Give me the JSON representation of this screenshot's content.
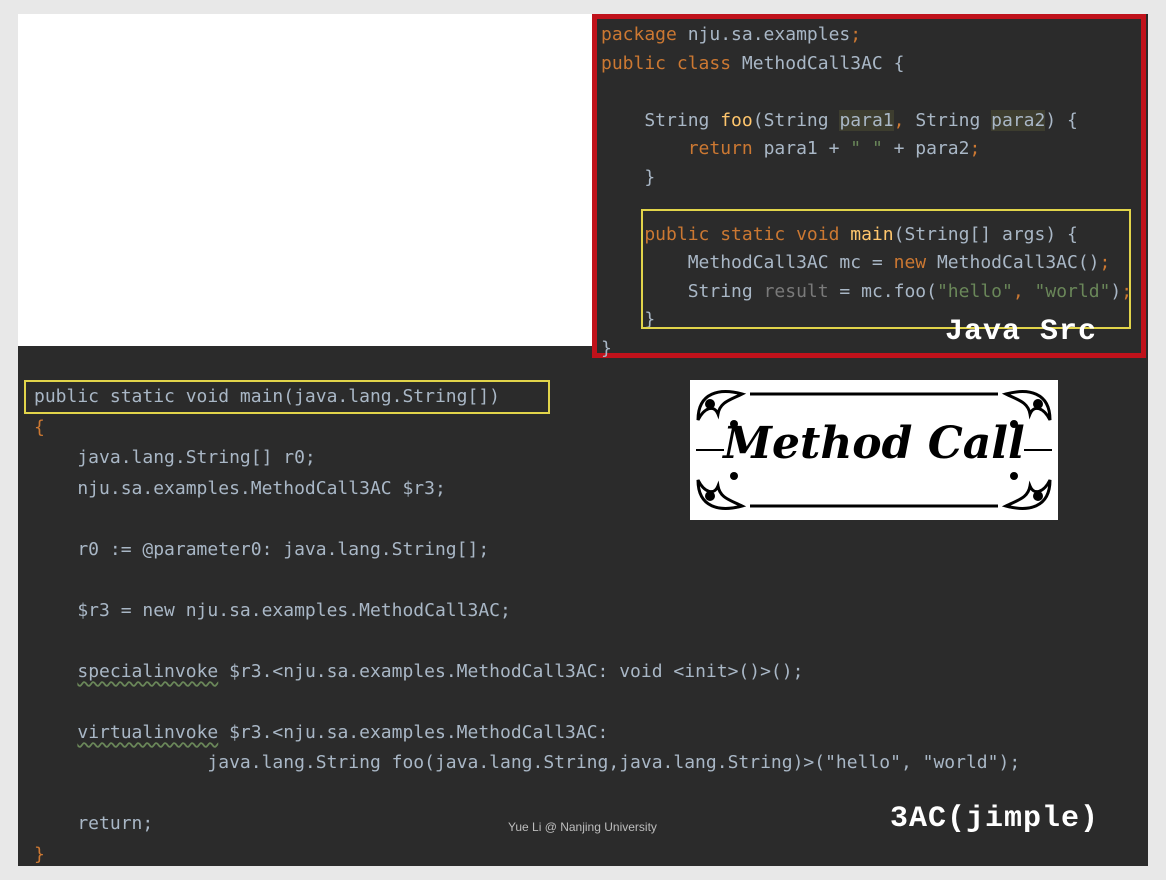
{
  "java_src": {
    "label": "Java Src",
    "lines": [
      [
        [
          "kw",
          "package "
        ],
        [
          "",
          "nju.sa.examples"
        ],
        [
          "kw",
          ";"
        ]
      ],
      [
        [
          "kw",
          "public class "
        ],
        [
          "",
          "MethodCall3AC {"
        ]
      ],
      [],
      [
        [
          "",
          "    String "
        ],
        [
          "fn",
          "foo"
        ],
        [
          "",
          "(String "
        ],
        [
          "param",
          "para1"
        ],
        [
          "kw",
          ", "
        ],
        [
          "",
          "String "
        ],
        [
          "param",
          "para2"
        ],
        [
          "",
          ") {"
        ]
      ],
      [
        [
          "kw",
          "        return "
        ],
        [
          "",
          "para1 + "
        ],
        [
          "str",
          "\" \""
        ],
        [
          "",
          " + para2"
        ],
        [
          "kw",
          ";"
        ]
      ],
      [
        [
          "",
          "    }"
        ]
      ],
      [],
      [
        [
          "kw",
          "    public static void "
        ],
        [
          "fn",
          "main"
        ],
        [
          "",
          "(String[] args) {"
        ]
      ],
      [
        [
          "",
          "        MethodCall3AC mc = "
        ],
        [
          "kw",
          "new "
        ],
        [
          "",
          "MethodCall3AC()"
        ],
        [
          "kw",
          ";"
        ]
      ],
      [
        [
          "",
          "        String "
        ],
        [
          "muted",
          "result"
        ],
        [
          "",
          " = mc.foo("
        ],
        [
          "str",
          "\"hello\""
        ],
        [
          "kw",
          ", "
        ],
        [
          "str",
          "\"world\""
        ],
        [
          "",
          ")"
        ],
        [
          "kw",
          ";"
        ]
      ],
      [
        [
          "",
          "    }"
        ]
      ],
      [
        [
          "",
          "}"
        ]
      ]
    ]
  },
  "jimple": {
    "label": "3AC(jimple)",
    "lines": [
      [
        [
          "",
          "public static void main(java.lang.String[])"
        ]
      ],
      [
        [
          "kw",
          "{"
        ]
      ],
      [
        [
          "",
          "    java.lang.String[] r0;"
        ]
      ],
      [
        [
          "",
          "    nju.sa.examples.MethodCall3AC $r3;"
        ]
      ],
      [],
      [
        [
          "",
          "    r0 := @parameter0: java.lang.String[];"
        ]
      ],
      [],
      [
        [
          "",
          "    $r3 = new nju.sa.examples.MethodCall3AC;"
        ]
      ],
      [],
      [
        [
          "squig-pad",
          "    "
        ],
        [
          "squig",
          "specialinvoke"
        ],
        [
          "",
          " $r3.<nju.sa.examples.MethodCall3AC: void <init>()>();"
        ]
      ],
      [],
      [
        [
          "squig-pad",
          "    "
        ],
        [
          "squig",
          "virtualinvoke"
        ],
        [
          "",
          " $r3.<nju.sa.examples.MethodCall3AC:"
        ]
      ],
      [
        [
          "",
          "                java.lang.String foo(java.lang.String,java.lang.String)>(\"hello\", \"world\");"
        ]
      ],
      [],
      [
        [
          "",
          "    return;"
        ]
      ],
      [
        [
          "kw",
          "}"
        ]
      ]
    ]
  },
  "badge": {
    "text": "Method Call"
  },
  "footer": "Yue Li @ Nanjing University"
}
